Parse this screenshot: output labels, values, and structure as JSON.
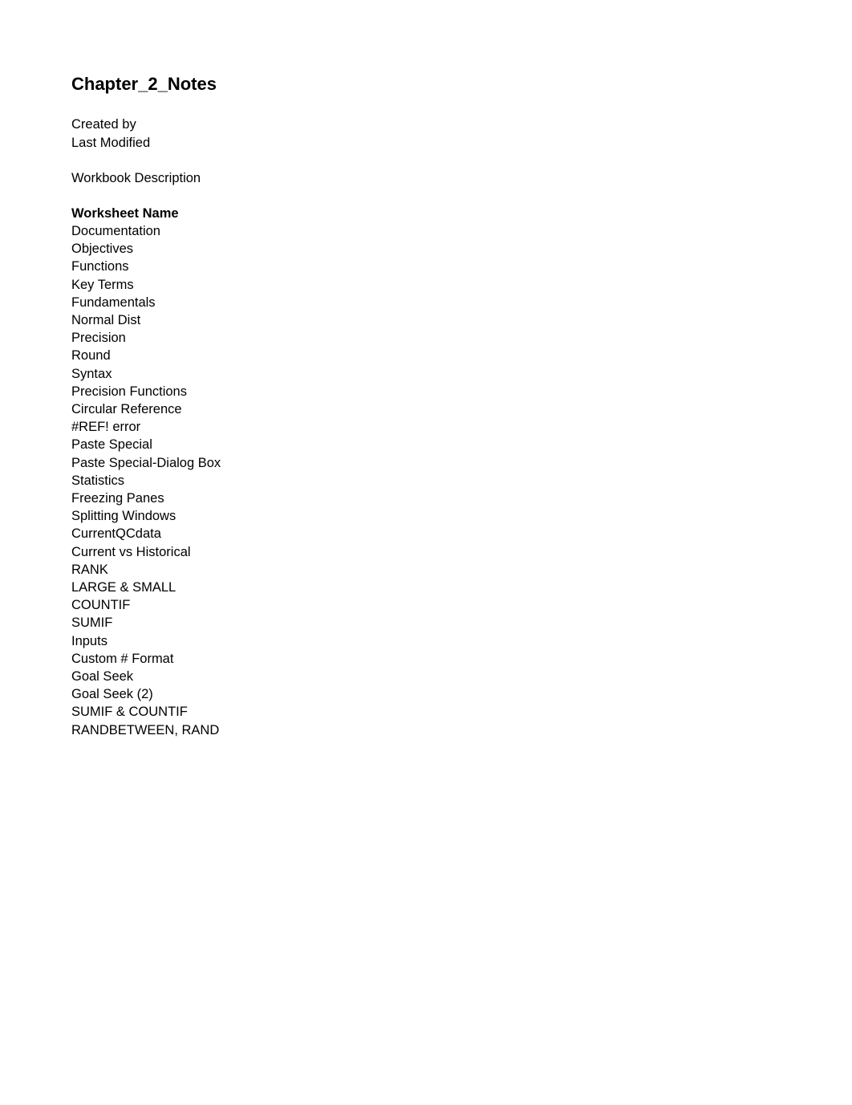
{
  "document": {
    "title": "Chapter_2_Notes",
    "metadata": [
      {
        "label": "Created by"
      },
      {
        "label": "Last Modified"
      }
    ],
    "description_label": "Workbook Description",
    "worksheet_section": {
      "header": "Worksheet Name",
      "items": [
        {
          "name": "Documentation"
        },
        {
          "name": "Objectives"
        },
        {
          "name": "Functions"
        },
        {
          "name": "Key Terms"
        },
        {
          "name": "Fundamentals"
        },
        {
          "name": "Normal Dist"
        },
        {
          "name": "Precision"
        },
        {
          "name": "Round"
        },
        {
          "name": "Syntax"
        },
        {
          "name": "Precision Functions"
        },
        {
          "name": "Circular Reference"
        },
        {
          "name": "#REF! error"
        },
        {
          "name": "Paste Special"
        },
        {
          "name": "Paste Special-Dialog Box"
        },
        {
          "name": "Statistics"
        },
        {
          "name": "Freezing Panes"
        },
        {
          "name": "Splitting Windows"
        },
        {
          "name": "CurrentQCdata"
        },
        {
          "name": "Current vs Historical"
        },
        {
          "name": "RANK"
        },
        {
          "name": "LARGE & SMALL"
        },
        {
          "name": "COUNTIF"
        },
        {
          "name": "SUMIF"
        },
        {
          "name": "Inputs"
        },
        {
          "name": "Custom # Format"
        },
        {
          "name": "Goal Seek"
        },
        {
          "name": "Goal Seek (2)"
        },
        {
          "name": "SUMIF & COUNTIF"
        },
        {
          "name": "RANDBETWEEN, RAND"
        }
      ]
    }
  },
  "colors": {
    "text": "#000000",
    "background": "#ffffff"
  }
}
